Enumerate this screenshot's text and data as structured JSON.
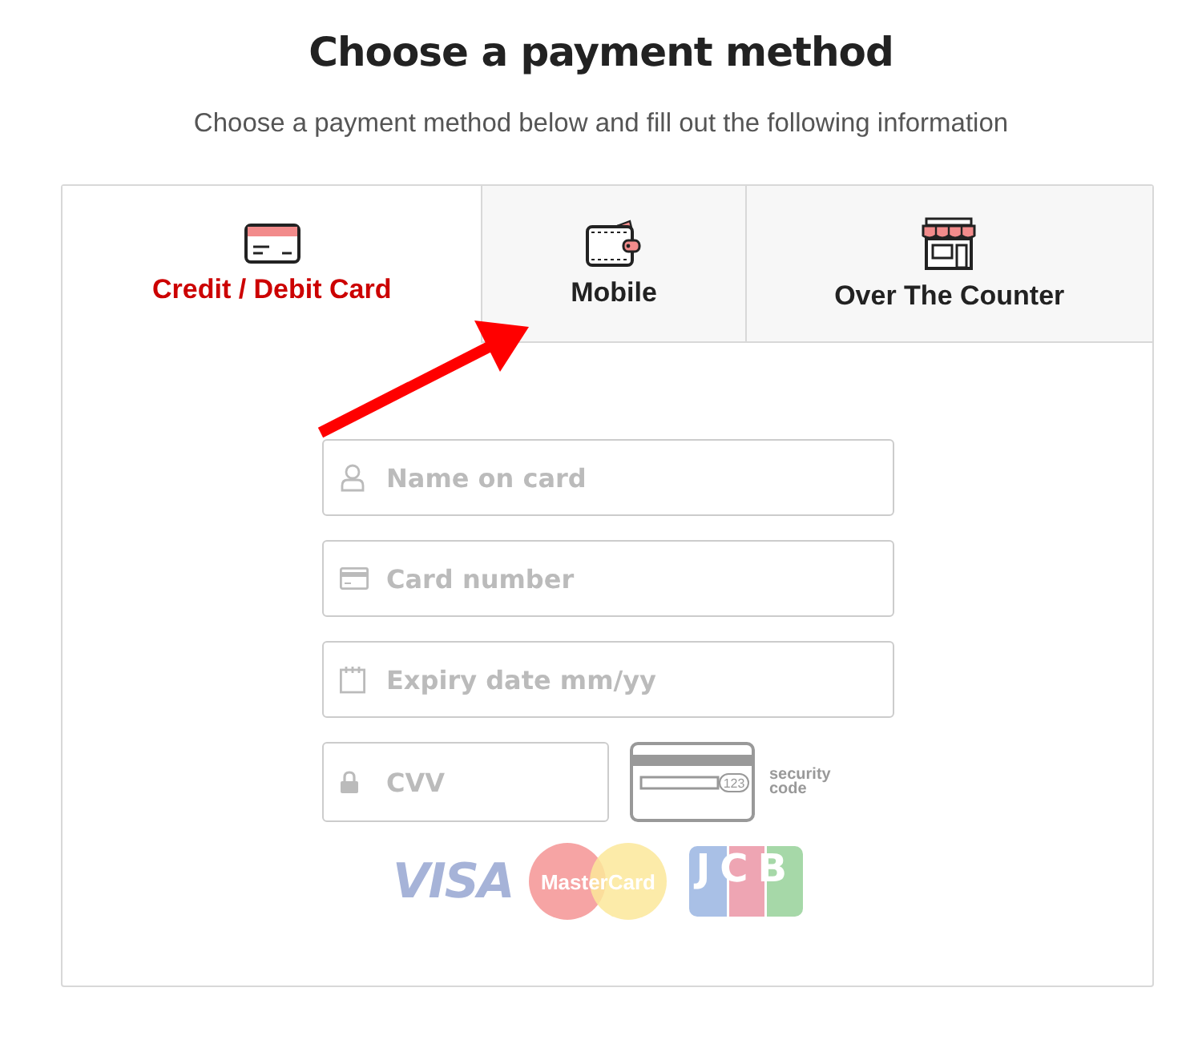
{
  "title": "Choose a payment method",
  "subtitle": "Choose a payment method below and fill out the following information",
  "tabs": [
    {
      "label": "Credit / Debit Card",
      "selected": true
    },
    {
      "label": "Mobile",
      "selected": false
    },
    {
      "label": "Over The Counter",
      "selected": false
    }
  ],
  "fields": [
    {
      "placeholder": "Name on card"
    },
    {
      "placeholder": "Card number"
    },
    {
      "placeholder": "Expiry date mm/yy"
    }
  ],
  "cvv": {
    "placeholder": "CVV",
    "card_number": "123",
    "hint": "security code"
  },
  "card_logos": [
    {
      "text": "VISA"
    },
    {
      "text": "MasterCard"
    },
    {
      "text": "JCB"
    }
  ]
}
